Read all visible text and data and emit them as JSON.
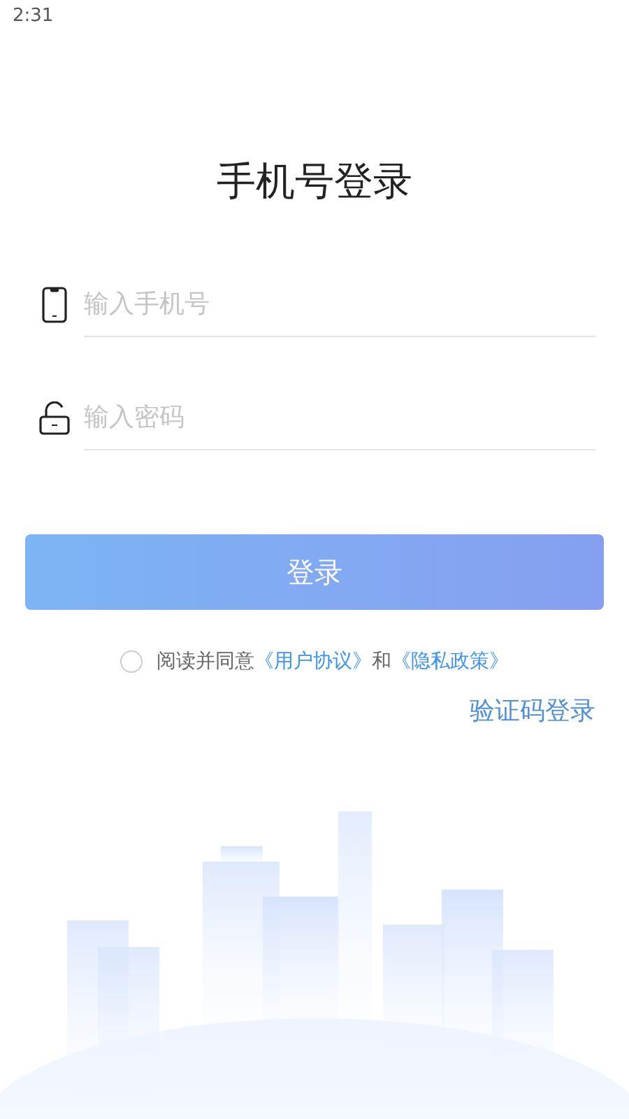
{
  "status_bar": {
    "time": "2:31"
  },
  "title": "手机号登录",
  "fields": [
    {
      "kind": "phone",
      "placeholder": "输入手机号"
    },
    {
      "kind": "password",
      "placeholder": "输入密码"
    }
  ],
  "login_button": {
    "label": "登录",
    "disabled": true
  },
  "agreement": {
    "checked": false,
    "text": "阅读并同意",
    "link_1": "《用户协议》",
    "joiner": "和",
    "link_2": "《隐私政策》"
  },
  "alt_login": "验证码登录"
}
